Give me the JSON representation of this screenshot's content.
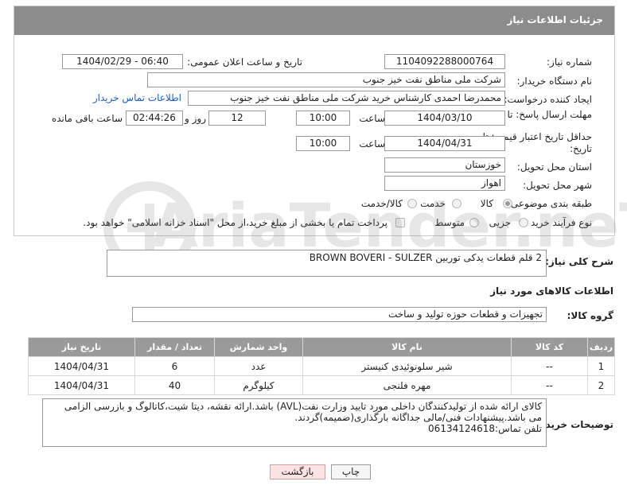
{
  "header": {
    "title": "جزئیات اطلاعات نیاز"
  },
  "form": {
    "need_number_label": "شماره نیاز:",
    "need_number": "1104092288000764",
    "announce_label": "تاریخ و ساعت اعلان عمومی:",
    "announce_value": "1404/02/29 - 06:40",
    "buyer_org_label": "نام دستگاه خریدار:",
    "buyer_org": "شرکت ملی مناطق نفت خیز جنوب",
    "creator_label": "ایجاد کننده درخواست:",
    "creator": "محمدرضا احمدی  کارشناس خرید  شرکت ملی مناطق نفت خیز جنوب",
    "contact_link": "اطلاعات تماس خریدار",
    "reply_deadline_label": "مهلت ارسال پاسخ: تا تاریخ:",
    "reply_date": "1404/03/10",
    "time_label": "ساعت",
    "reply_time": "10:00",
    "days_value": "12",
    "days_label": "روز و",
    "remaining_time": "02:44:26",
    "remaining_label": "ساعت باقی مانده",
    "price_validity_label": "حداقل تاریخ اعتبار قیمت: تا تاریخ:",
    "price_date": "1404/04/31",
    "price_time": "10:00",
    "province_label": "استان محل تحویل:",
    "province": "خوزستان",
    "city_label": "شهر محل تحویل:",
    "city": "اهواز",
    "category_label": "طبقه بندی موضوعی:",
    "category_options": [
      "کالا",
      "خدمت",
      "کالا/خدمت"
    ],
    "process_label": "نوع فرآیند خرید :",
    "process_options": [
      "جزیی",
      "متوسط"
    ],
    "payment_note": "پرداخت تمام یا بخشی از مبلغ خرید،از محل \"اسناد خزانه اسلامی\" خواهد بود."
  },
  "description": {
    "label": "شرح کلی نیاز:",
    "value": "2 قلم قطعات یدکی توربین BROWN BOVERI - SULZER"
  },
  "goods_section_title": "اطلاعات کالاهای مورد نیاز",
  "goods_group": {
    "label": "گروه کالا:",
    "value": "تجهیزات و قطعات حوزه تولید و ساخت"
  },
  "table": {
    "headers": [
      "ردیف",
      "کد کالا",
      "نام کالا",
      "واحد شمارش",
      "تعداد / مقدار",
      "تاریخ نیاز"
    ],
    "rows": [
      [
        "1",
        "--",
        "شیر سلونوئیدی کنیستر",
        "عدد",
        "6",
        "1404/04/31"
      ],
      [
        "2",
        "--",
        "مهره فلنجی",
        "کیلوگرم",
        "40",
        "1404/04/31"
      ]
    ]
  },
  "buyer_notes": {
    "label": "توضیحات خریدار:",
    "lines": [
      "کالای ارائه شده از تولیدکنندگان داخلی مورد تایید وزارت نفت(AVL) باشد.ارائه نقشه، دیتا شیت،کاتالوگ و بازرسی الزامی",
      "می باشد.پیشنهادات فنی/مالی جداگانه بارگذاری(ضمیمه)گردند.",
      "تلفن تماس:06134124618"
    ]
  },
  "buttons": {
    "print": "چاپ",
    "back": "بازگشت"
  },
  "watermark": {
    "text": "AriaTender.neT"
  },
  "colors": {
    "header_bg": "#8c8c8c",
    "link": "#1a5ec7",
    "back_btn_bg": "#fbe3e3"
  }
}
